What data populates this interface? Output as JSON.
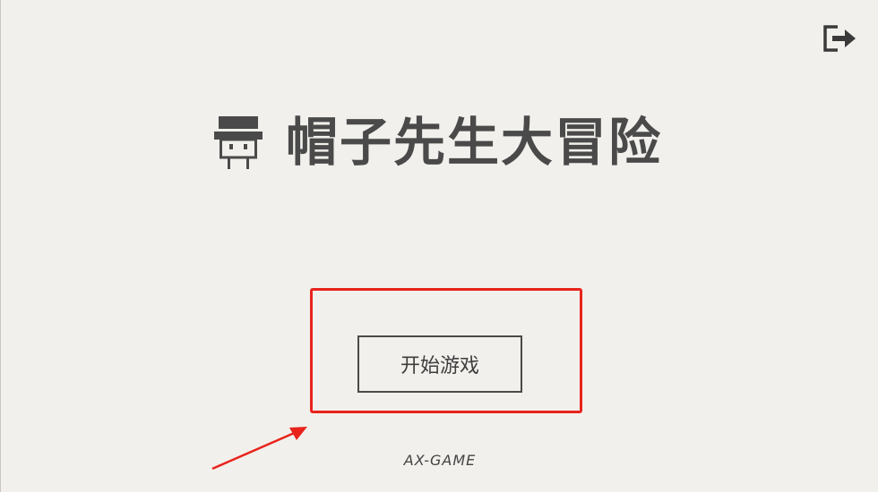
{
  "game": {
    "title": "帽子先生大冒险",
    "start_button_label": "开始游戏",
    "credit": "AX-GAME"
  },
  "icons": {
    "exit": "logout-icon",
    "logo": "mr-hat-character-icon"
  },
  "annotations": {
    "highlight_color": "#e8231c",
    "arrow_color": "#e8231c"
  },
  "colors": {
    "background": "#f2f0ec",
    "text": "#4a4a4a"
  }
}
